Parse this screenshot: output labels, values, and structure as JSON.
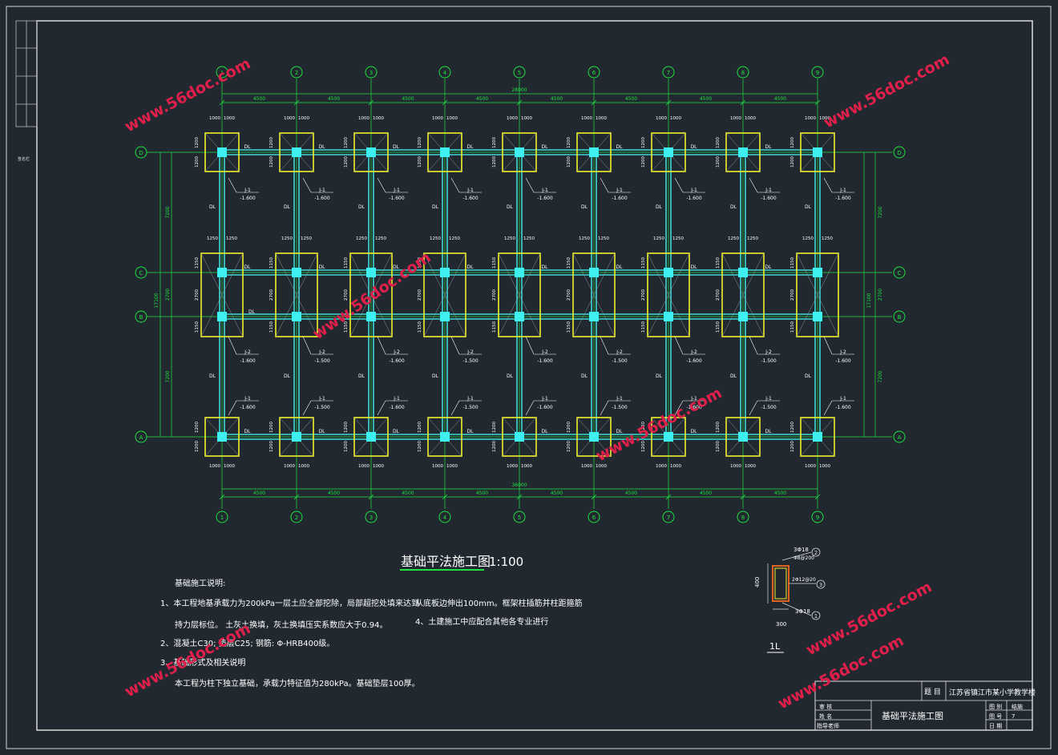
{
  "drawing": {
    "title": "基础平法施工图",
    "scale": "1:100",
    "grid_letters": [
      "D",
      "C",
      "B",
      "A"
    ],
    "grid_numbers": [
      "1",
      "2",
      "3",
      "4",
      "5",
      "6",
      "7",
      "8",
      "9"
    ],
    "span_labels": [
      "4500",
      "4500",
      "4500",
      "4500",
      "4500",
      "4500",
      "4500",
      "4500"
    ],
    "top_total": "28000",
    "bottom_total": "36000",
    "left_dims": [
      "7200",
      "2700",
      "7200"
    ],
    "left_total": "17100",
    "pad_dims_top": [
      "1000",
      "1000"
    ],
    "pad_dims_mid": [
      "1250",
      "1250"
    ],
    "pad_dim_side_a": "1200",
    "pad_dim_side_b": "1150",
    "pad_dim_mid_span": "2700",
    "beam_label": "DL",
    "footing_j1": "J-1",
    "footing_j2": "J-2",
    "footing_elev": "-1.600",
    "footing_elev_alt": "-1.500"
  },
  "notes": {
    "heading": "基础施工说明:",
    "line1": "1、本工程地基承载力为200kPa一层土应全部挖除，局部超挖处填来达到",
    "line2": "持力层标位。 土灰土换填，灰土换填压实系数应大于0.94。",
    "line3": "2、混凝土C30; 垫层C25; 钢筋: Φ-HRB400级。",
    "line4": "3、基础形式及相关说明",
    "line5": "本工程为柱下独立基础，承载力特征值为280kPa。基础垫层100厚。",
    "right1": "从底板边伸出100mm。框架柱插筋并柱距箍筋",
    "right2": "4、土建施工中应配合其他各专业进行"
  },
  "section": {
    "label": "1L",
    "top_rebar": "3Φ18",
    "top_sub": "Φ8@200",
    "side_rebar": "2Φ12@20",
    "bottom_rebar": "3Φ18",
    "height_dim": "400",
    "width_dim": "300",
    "callouts": [
      "2",
      "3",
      "1"
    ]
  },
  "title_block": {
    "topic_label": "题 目",
    "topic_value": "江苏省镇江市某小学教学楼",
    "drawing_name": "基础平法施工图",
    "row1": "审 核",
    "row2": "姓 名",
    "row3": "指导老师",
    "k1": "图 别",
    "k2": "图 号",
    "k3": "日 期",
    "v1": "结施",
    "v2": "7"
  },
  "stamp": {
    "vertical_note": "签名栏"
  },
  "watermark": {
    "text": "www.56doc.com"
  },
  "colors": {
    "background": "#212830",
    "grid": "#1ee33e",
    "footing": "#f0f02a",
    "beam": "#3fd7d6",
    "column": "#3ff0f0",
    "text": "#ffffff",
    "watermark": "#e0204a"
  }
}
